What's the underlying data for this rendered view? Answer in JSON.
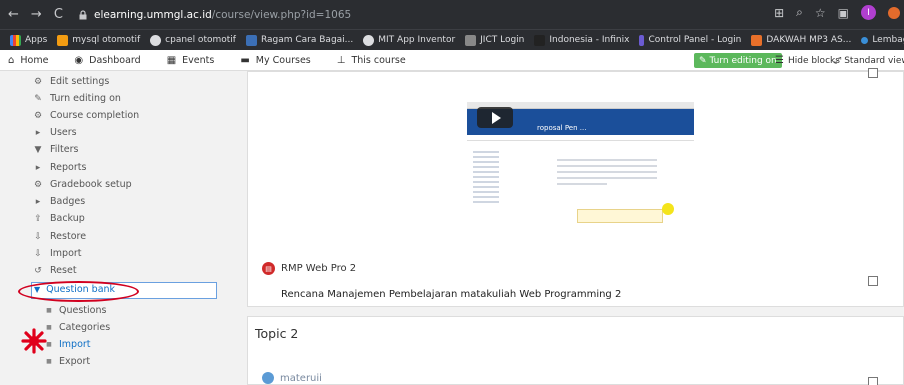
{
  "browser": {
    "url_host": "elearning.ummgl.ac.id",
    "url_path": "/course/view.php?id=1065",
    "profile_initial": "I",
    "bookmarks": [
      "Apps",
      "mysql otomotif",
      "cpanel otomotif",
      "Ragam Cara Bagai...",
      "MIT App Inventor",
      "JICT Login",
      "Indonesia - Infinix",
      "Control Panel - Login",
      "DAKWAH MP3 AS...",
      "Lembaga Pengemb..."
    ],
    "bookmarks_more": "»"
  },
  "navbar": {
    "home": "Home",
    "dashboard": "Dashboard",
    "events": "Events",
    "my_courses": "My Courses",
    "this_course": "This course",
    "turn_editing": "Turn editing on",
    "hide_blocks": "Hide blocks",
    "standard_view": "Standard view"
  },
  "sidebar": {
    "items": [
      "Edit settings",
      "Turn editing on",
      "Course completion",
      "Users",
      "Filters",
      "Reports",
      "Gradebook setup",
      "Badges",
      "Backup",
      "Restore",
      "Import",
      "Reset"
    ],
    "question_bank": "Question bank",
    "sub_items": [
      "Questions",
      "Categories",
      "Import",
      "Export"
    ]
  },
  "main": {
    "video_header": "roposal Pen ...",
    "resource_title": "RMP Web Pro 2",
    "resource_desc": "Rencana Manajemen Pembelajaran matakuliah Web Programming 2",
    "topic2_title": "Topic 2",
    "topic2_item": "materuii"
  },
  "colors": {
    "accent": "#0f6fc5",
    "annotation_red": "#d1001f",
    "button_green": "#5cb85c"
  }
}
